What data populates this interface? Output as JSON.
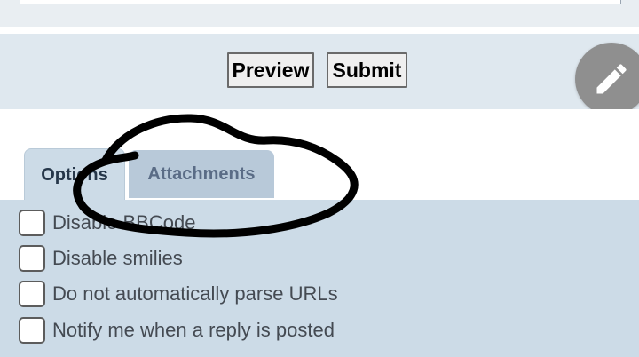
{
  "buttons": {
    "preview_label": "Preview",
    "submit_label": "Submit"
  },
  "fab": {
    "icon": "pencil-icon"
  },
  "tabs": [
    {
      "label": "Options",
      "active": true
    },
    {
      "label": "Attachments",
      "active": false
    }
  ],
  "options": [
    {
      "label": "Disable BBCode",
      "checked": false
    },
    {
      "label": "Disable smilies",
      "checked": false
    },
    {
      "label": "Do not automatically parse URLs",
      "checked": false
    },
    {
      "label": "Notify me when a reply is posted",
      "checked": false
    }
  ],
  "colors": {
    "panel_bg": "#ccdbe7",
    "submit_bar_bg": "#dfe8ef",
    "inactive_tab_bg": "#b8c9d9",
    "fab_bg": "#8f8f8f",
    "scribble": "#000000"
  }
}
